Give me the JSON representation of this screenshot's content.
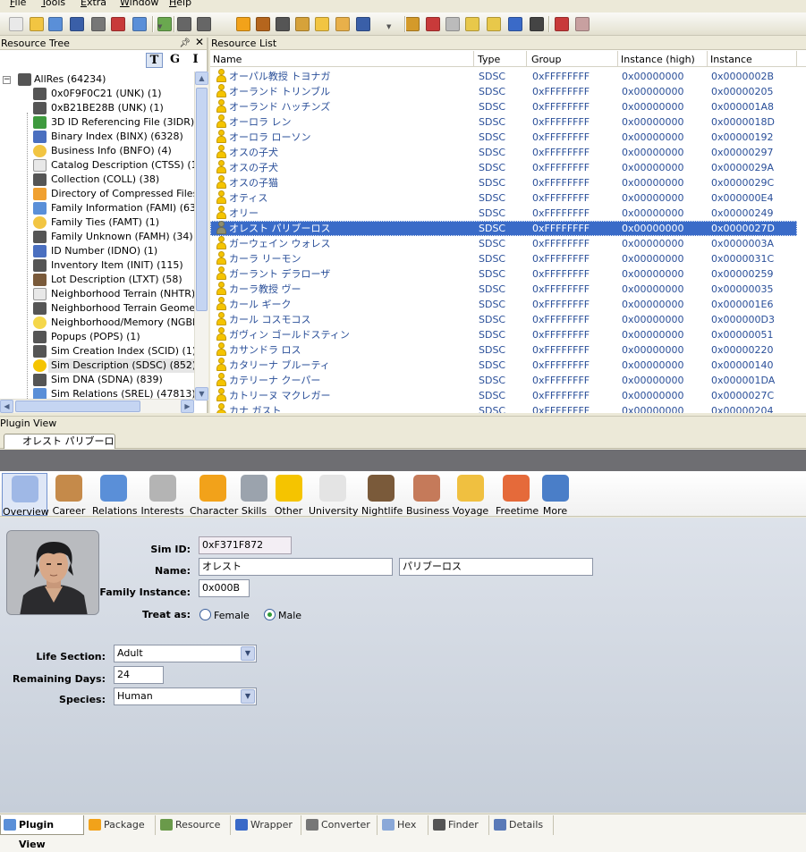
{
  "menu": [
    "File",
    "Tools",
    "Extra",
    "Window",
    "Help"
  ],
  "toolbar_icons": [
    "new-icon",
    "open-icon",
    "save-icon",
    "save-as-icon",
    "close-icon",
    "plugin-icon",
    "find-icon",
    "package-icon",
    "cut-icon",
    "copy-icon",
    "gear-icon",
    "stamp-icon",
    "film-icon",
    "people-icon",
    "person-add-icon",
    "folder-icon",
    "save-small-icon",
    "undo-icon",
    "delete-icon",
    "comment-icon",
    "note-icon",
    "notes-icon",
    "refresh-icon",
    "bird-icon",
    "tools-icon",
    "eraser-icon"
  ],
  "tree": {
    "title": "Resource Tree",
    "filters": [
      "T",
      "G",
      "I"
    ],
    "root": {
      "label": "AllRes (64234)",
      "expander": "−"
    },
    "items": [
      {
        "label": "0x0F9F0C21 (UNK) (1)",
        "icon": "gray"
      },
      {
        "label": "0xB21BE28B (UNK) (1)",
        "icon": "gray"
      },
      {
        "label": "3D ID Referencing File (3IDR) (63",
        "icon": "green"
      },
      {
        "label": "Binary Index (BINX) (6328)",
        "icon": "blue"
      },
      {
        "label": "Business Info (BNFO) (4)",
        "icon": "yellow"
      },
      {
        "label": "Catalog Description (CTSS) (1)",
        "icon": "doc"
      },
      {
        "label": "Collection (COLL) (38)",
        "icon": "gray"
      },
      {
        "label": "Directory of Compressed Files (C",
        "icon": "orange"
      },
      {
        "label": "Family Information (FAMI) (63)",
        "icon": "people"
      },
      {
        "label": "Family Ties (FAMT) (1)",
        "icon": "yellow"
      },
      {
        "label": "Family Unknown (FAMH) (34)",
        "icon": "gray"
      },
      {
        "label": "ID Number (IDNO) (1)",
        "icon": "blue"
      },
      {
        "label": "Inventory Item (INIT) (115)",
        "icon": "gray"
      },
      {
        "label": "Lot Description (LTXT) (58)",
        "icon": "house"
      },
      {
        "label": "Neighborhood Terrain (NHTR) (1)",
        "icon": "doc"
      },
      {
        "label": "Neighborhood Terrain Geometry",
        "icon": "gray"
      },
      {
        "label": "Neighborhood/Memory (NGBH) (1",
        "icon": "bulb"
      },
      {
        "label": "Popups (POPS) (1)",
        "icon": "gray"
      },
      {
        "label": "Sim Creation Index (SCID) (1)",
        "icon": "gray"
      },
      {
        "label": "Sim Description (SDSC) (852)",
        "icon": "sim",
        "selected": true
      },
      {
        "label": "Sim DNA (SDNA) (839)",
        "icon": "gray"
      },
      {
        "label": "Sim Relations (SREL) (47813)",
        "icon": "people"
      }
    ]
  },
  "list": {
    "title": "Resource List",
    "columns": [
      "Name",
      "Type",
      "Group",
      "Instance (high)",
      "Instance"
    ],
    "rows": [
      {
        "name": "オーパル教授 トヨナガ",
        "type": "SDSC",
        "group": "0xFFFFFFFF",
        "high": "0x00000000",
        "instance": "0x0000002B"
      },
      {
        "name": "オーランド トリンブル",
        "type": "SDSC",
        "group": "0xFFFFFFFF",
        "high": "0x00000000",
        "instance": "0x00000205"
      },
      {
        "name": "オーランド ハッチンズ",
        "type": "SDSC",
        "group": "0xFFFFFFFF",
        "high": "0x00000000",
        "instance": "0x000001A8"
      },
      {
        "name": "オーロラ レン",
        "type": "SDSC",
        "group": "0xFFFFFFFF",
        "high": "0x00000000",
        "instance": "0x0000018D"
      },
      {
        "name": "オーロラ ローソン",
        "type": "SDSC",
        "group": "0xFFFFFFFF",
        "high": "0x00000000",
        "instance": "0x00000192"
      },
      {
        "name": "オスの子犬",
        "type": "SDSC",
        "group": "0xFFFFFFFF",
        "high": "0x00000000",
        "instance": "0x00000297"
      },
      {
        "name": "オスの子犬",
        "type": "SDSC",
        "group": "0xFFFFFFFF",
        "high": "0x00000000",
        "instance": "0x0000029A"
      },
      {
        "name": "オスの子猫",
        "type": "SDSC",
        "group": "0xFFFFFFFF",
        "high": "0x00000000",
        "instance": "0x0000029C"
      },
      {
        "name": "オティス",
        "type": "SDSC",
        "group": "0xFFFFFFFF",
        "high": "0x00000000",
        "instance": "0x000000E4"
      },
      {
        "name": "オリー",
        "type": "SDSC",
        "group": "0xFFFFFFFF",
        "high": "0x00000000",
        "instance": "0x00000249"
      },
      {
        "name": "オレスト パリブーロス",
        "type": "SDSC",
        "group": "0xFFFFFFFF",
        "high": "0x00000000",
        "instance": "0x0000027D",
        "selected": true
      },
      {
        "name": "ガーウェイン ウォレス",
        "type": "SDSC",
        "group": "0xFFFFFFFF",
        "high": "0x00000000",
        "instance": "0x0000003A"
      },
      {
        "name": "カーラ リーモン",
        "type": "SDSC",
        "group": "0xFFFFFFFF",
        "high": "0x00000000",
        "instance": "0x0000031C"
      },
      {
        "name": "ガーラント デラローザ",
        "type": "SDSC",
        "group": "0xFFFFFFFF",
        "high": "0x00000000",
        "instance": "0x00000259"
      },
      {
        "name": "カーラ教授 ヴー",
        "type": "SDSC",
        "group": "0xFFFFFFFF",
        "high": "0x00000000",
        "instance": "0x00000035"
      },
      {
        "name": "カール ギーク",
        "type": "SDSC",
        "group": "0xFFFFFFFF",
        "high": "0x00000000",
        "instance": "0x000001E6"
      },
      {
        "name": "カール コスモコス",
        "type": "SDSC",
        "group": "0xFFFFFFFF",
        "high": "0x00000000",
        "instance": "0x000000D3"
      },
      {
        "name": "ガヴィン ゴールドスティン",
        "type": "SDSC",
        "group": "0xFFFFFFFF",
        "high": "0x00000000",
        "instance": "0x00000051"
      },
      {
        "name": "カサンドラ ロス",
        "type": "SDSC",
        "group": "0xFFFFFFFF",
        "high": "0x00000000",
        "instance": "0x00000220"
      },
      {
        "name": "カタリーナ ブルーティ",
        "type": "SDSC",
        "group": "0xFFFFFFFF",
        "high": "0x00000000",
        "instance": "0x00000140"
      },
      {
        "name": "カテリーナ クーパー",
        "type": "SDSC",
        "group": "0xFFFFFFFF",
        "high": "0x00000000",
        "instance": "0x000001DA"
      },
      {
        "name": "カトリーヌ マクレガー",
        "type": "SDSC",
        "group": "0xFFFFFFFF",
        "high": "0x00000000",
        "instance": "0x0000027C"
      },
      {
        "name": "カナ ガスト",
        "type": "SDSC",
        "group": "0xFFFFFFFF",
        "high": "0x00000000",
        "instance": "0x00000204"
      }
    ]
  },
  "plugin": {
    "title": "Plugin View",
    "doc_tab": "オレスト パリブーロス",
    "categories": [
      {
        "label": "Overview",
        "icon": "overview-icon",
        "color": "#9fb8e6",
        "active": true
      },
      {
        "label": "Career",
        "icon": "career-icon",
        "color": "#c58a4a"
      },
      {
        "label": "Relations",
        "icon": "relations-icon",
        "color": "#5a8fd8"
      },
      {
        "label": "Interests",
        "icon": "interests-icon",
        "color": "#b4b4b4"
      },
      {
        "label": "Character",
        "icon": "character-icon",
        "color": "#f2a21a"
      },
      {
        "label": "Skills",
        "icon": "skills-icon",
        "color": "#9ba3ad"
      },
      {
        "label": "Other",
        "icon": "other-icon",
        "color": "#f5c400"
      },
      {
        "label": "University",
        "icon": "university-icon",
        "color": "#e4e4e4"
      },
      {
        "label": "Nightlife",
        "icon": "nightlife-icon",
        "color": "#7a5a3a"
      },
      {
        "label": "Business",
        "icon": "business-icon",
        "color": "#c57a5a"
      },
      {
        "label": "Voyage",
        "icon": "voyage-icon",
        "color": "#f0c040"
      },
      {
        "label": "Freetime",
        "icon": "freetime-icon",
        "color": "#e56a3a"
      },
      {
        "label": "More",
        "icon": "more-icon",
        "color": "#4a7ec8"
      }
    ],
    "form": {
      "sim_id_label": "Sim ID:",
      "sim_id": "0xF371F872",
      "name_label": "Name:",
      "first_name": "オレスト",
      "last_name": "パリブーロス",
      "family_label": "Family Instance:",
      "family": "0x000B",
      "treat_label": "Treat as:",
      "female": "Female",
      "male": "Male",
      "gender": "Male",
      "life_label": "Life Section:",
      "life": "Adult",
      "days_label": "Remaining Days:",
      "days": "24",
      "species_label": "Species:",
      "species": "Human"
    }
  },
  "bottom_tabs": [
    {
      "label": "Plugin View",
      "active": true,
      "color": "#5a8fd8"
    },
    {
      "label": "Package",
      "color": "#f2a21a"
    },
    {
      "label": "Resource",
      "color": "#6a9a4a"
    },
    {
      "label": "Wrapper",
      "color": "#3a6ac8"
    },
    {
      "label": "Converter",
      "color": "#777777"
    },
    {
      "label": "Hex",
      "color": "#8aa8d8"
    },
    {
      "label": "Finder",
      "color": "#555555"
    },
    {
      "label": "Details",
      "color": "#5a7ab8"
    }
  ]
}
